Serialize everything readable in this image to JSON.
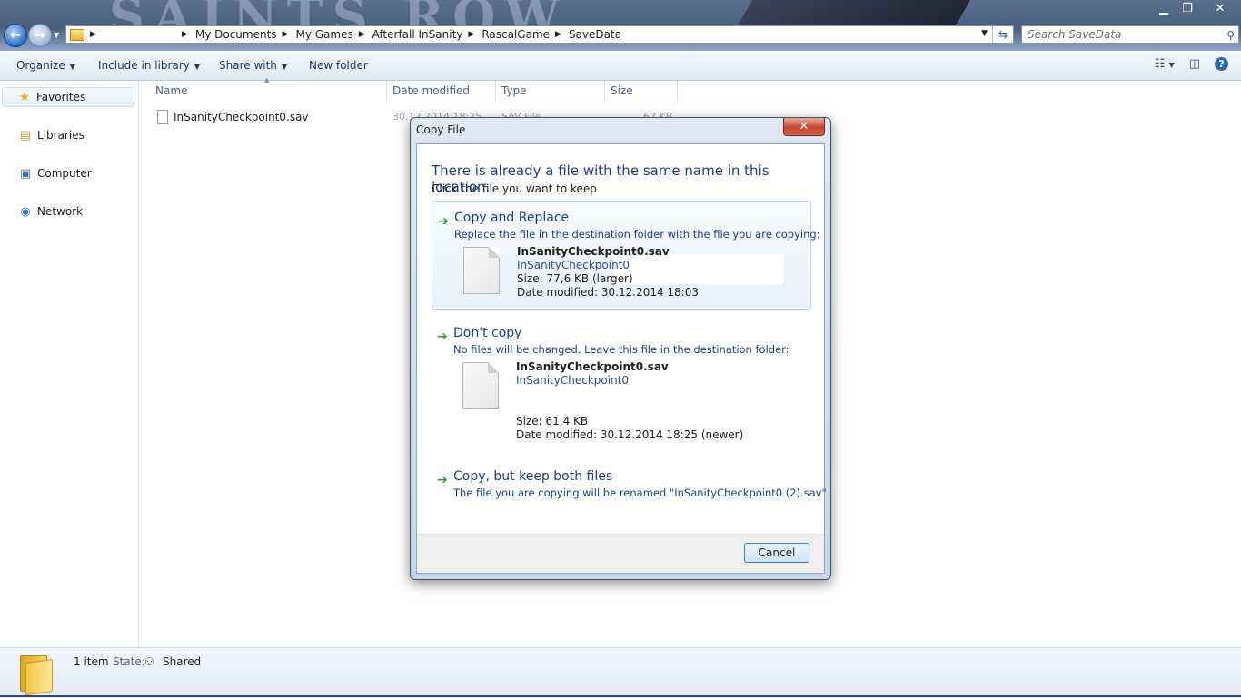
{
  "window": {
    "breadcrumb": [
      "My Documents",
      "My Games",
      "Afterfall InSanity",
      "RascalGame",
      "SaveData"
    ],
    "search_placeholder": "Search SaveData"
  },
  "toolbar": {
    "organize": "Organize",
    "include_in_library": "Include in library",
    "share_with": "Share with",
    "new_folder": "New folder"
  },
  "nav": {
    "favorites": "Favorites",
    "libraries": "Libraries",
    "computer": "Computer",
    "network": "Network"
  },
  "columns": {
    "name": "Name",
    "date_modified": "Date modified",
    "type": "Type",
    "size": "Size"
  },
  "files": [
    {
      "name": "InSanityCheckpoint0.sav",
      "date": "30.12.2014 18:25",
      "type": "SAV File",
      "size": "62 KB"
    }
  ],
  "status": {
    "count": "1 item",
    "state_label": "State:",
    "state_value": "Shared"
  },
  "dialog": {
    "title": "Copy File",
    "close": "✕",
    "heading": "There is already a file with the same name in this location.",
    "subheading": "Click the file you want to keep",
    "options": [
      {
        "title": "Copy and Replace",
        "desc": "Replace the file in the destination folder with the file you are copying:",
        "file_name": "InSanityCheckpoint0.sav",
        "file_sub": "InSanityCheckpoint0",
        "size": "Size: 77,6 KB (larger)",
        "date": "Date modified: 30.12.2014 18:03"
      },
      {
        "title": "Don't copy",
        "desc": "No files will be changed. Leave this file in the destination folder:",
        "file_name": "InSanityCheckpoint0.sav",
        "file_sub": "InSanityCheckpoint0",
        "size": "Size: 61,4 KB",
        "date": "Date modified: 30.12.2014 18:25 (newer)"
      },
      {
        "title": "Copy, but keep both files",
        "desc": "The file you are copying will be renamed \"InSanityCheckpoint0 (2).sav\""
      }
    ],
    "cancel": "Cancel"
  }
}
